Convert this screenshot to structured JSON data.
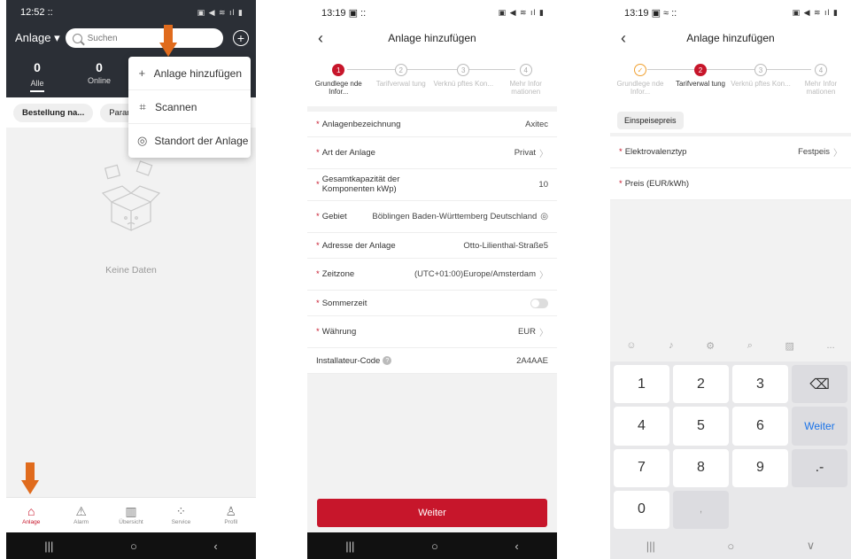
{
  "screen1": {
    "status_time": "12:52 ::",
    "status_icons": "▣ ◀ ≋ ıl ▮",
    "plant_selector": "Anlage ▾",
    "search_placeholder": "Suchen",
    "add_icon": "plus-circle-icon",
    "stats": [
      {
        "num": "0",
        "label": "Alle"
      },
      {
        "num": "0",
        "label": "Online"
      }
    ],
    "filters": [
      "Bestellung na...",
      "Param"
    ],
    "dropdown": [
      {
        "icon": "plus-icon",
        "glyph": "+",
        "label": "Anlage hinzufügen"
      },
      {
        "icon": "scan-icon",
        "glyph": "⌗",
        "label": "Scannen"
      },
      {
        "icon": "location-icon",
        "glyph": "◎",
        "label": "Standort der Anlage"
      }
    ],
    "empty_label": "Keine Daten",
    "tabs": [
      {
        "icon": "home-icon",
        "glyph": "⌂",
        "label": "Anlage"
      },
      {
        "icon": "alarm-icon",
        "glyph": "⚠",
        "label": "Alarm"
      },
      {
        "icon": "chart-icon",
        "glyph": "▥",
        "label": "Übersicht"
      },
      {
        "icon": "service-icon",
        "glyph": "⁘",
        "label": "Service"
      },
      {
        "icon": "profile-icon",
        "glyph": "♙",
        "label": "Profil"
      }
    ],
    "nav": [
      "|||",
      "○",
      "‹"
    ]
  },
  "screen2": {
    "status_time": "13:19 ▣ ::",
    "status_icons": "▣ ◀ ≋ ıl ▮",
    "title": "Anlage hinzufügen",
    "steps": [
      {
        "num": "1",
        "label": "Grundlege nde Infor..."
      },
      {
        "num": "2",
        "label": "Tarifverwal tung"
      },
      {
        "num": "3",
        "label": "Verknü pftes Kon..."
      },
      {
        "num": "4",
        "label": "Mehr Infor mationen"
      }
    ],
    "fields": [
      {
        "key": "Anlagenbezeichnung",
        "value": "Axitec",
        "required": "*"
      },
      {
        "key": "Art der Anlage",
        "value": "Privat",
        "required": "*"
      },
      {
        "key": "Gesamtkapazität der Komponenten kWp)",
        "value": "10",
        "required": "*"
      },
      {
        "key": "Gebiet",
        "value": "Böblingen Baden-Württemberg Deutschland",
        "required": "*"
      },
      {
        "key": "Adresse der Anlage",
        "value": "Otto-Lilienthal-Straße5",
        "required": "*"
      },
      {
        "key": "Zeitzone",
        "value": "(UTC+01:00)Europe/Amsterdam",
        "required": "*"
      },
      {
        "key": "Sommerzeit",
        "value": "",
        "required": "*"
      },
      {
        "key": "Währung",
        "value": "EUR",
        "required": "*"
      },
      {
        "key": "Installateur-Code",
        "value": "2A4AAE",
        "required": ""
      }
    ],
    "next_button": "Weiter",
    "nav": [
      "|||",
      "○",
      "‹"
    ]
  },
  "screen3": {
    "status_time": "13:19 ▣ ≈ ::",
    "status_icons": "▣ ◀ ≋ ıl ▮",
    "title": "Anlage hinzufügen",
    "steps": [
      {
        "num": "✓",
        "label": "Grundlege nde Infor..."
      },
      {
        "num": "2",
        "label": "Tarifverwal tung"
      },
      {
        "num": "3",
        "label": "Verknü pftes Kon..."
      },
      {
        "num": "4",
        "label": "Mehr Infor mationen"
      }
    ],
    "section_chip": "Einspeisepreis",
    "fields": [
      {
        "key": "Elektrovalenztyp",
        "value": "Festpeis",
        "required": "*"
      },
      {
        "key": "Preis (EUR/kWh)",
        "value": "",
        "required": "*"
      }
    ],
    "keyboard_tools": [
      "☺",
      "♪",
      "⚙",
      "⌕",
      "▨",
      "..."
    ],
    "keys": [
      "1",
      "2",
      "3",
      "⌫",
      "4",
      "5",
      "6",
      "Weiter",
      "7",
      "8",
      "9",
      ".-",
      "",
      "0",
      "",
      ","
    ],
    "nav": [
      "|||",
      "○",
      "∨"
    ]
  }
}
